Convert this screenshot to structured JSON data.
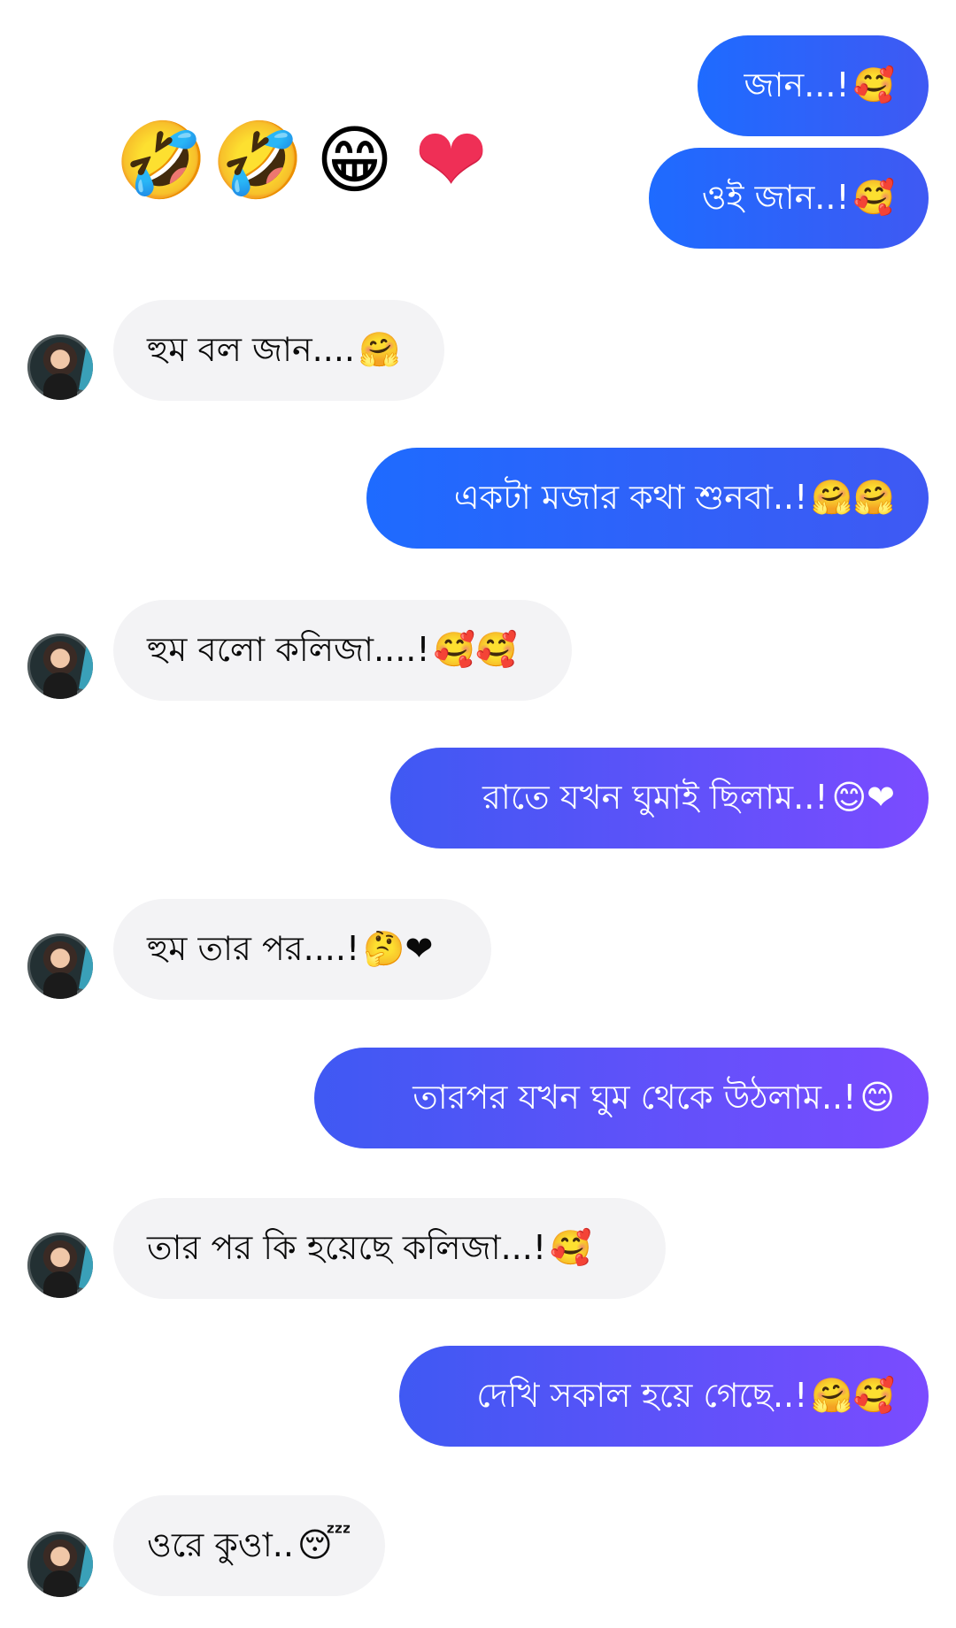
{
  "chat": {
    "top_fragment": "",
    "big_emojis": [
      "🤣",
      "🤣",
      "😁",
      "❤"
    ],
    "messages": [
      {
        "id": "m1",
        "side": "out",
        "text": "জান...!",
        "emoji": "🥰"
      },
      {
        "id": "m2",
        "side": "out",
        "text": "ওই জান..!",
        "emoji": "🥰"
      },
      {
        "id": "m3",
        "side": "in",
        "text": "হুম বল জান....",
        "emoji": "🤗"
      },
      {
        "id": "m4",
        "side": "out",
        "text": "একটা মজার কথা শুনবা..!",
        "emoji": "🤗🤗"
      },
      {
        "id": "m5",
        "side": "in",
        "text": "হুম বলো কলিজা....!",
        "emoji": "🥰🥰"
      },
      {
        "id": "m6",
        "side": "out",
        "text": "রাতে যখন ঘুমাই ছিলাম..!",
        "emoji": "😊❤"
      },
      {
        "id": "m7",
        "side": "in",
        "text": "হুম তার পর....!",
        "emoji": "🤔❤"
      },
      {
        "id": "m8",
        "side": "out",
        "text": "তারপর যখন ঘুম থেকে উঠলাম..!",
        "emoji": "😊"
      },
      {
        "id": "m9",
        "side": "in",
        "text": "তার পর কি হয়েছে কলিজা...!",
        "emoji": "🥰"
      },
      {
        "id": "m10",
        "side": "out",
        "text": "দেখি সকাল হয়ে গেছে..!",
        "emoji": "🤗🥰"
      },
      {
        "id": "m11",
        "side": "in",
        "text": "ওরে কুওা..",
        "emoji": "😴"
      }
    ]
  },
  "colors": {
    "outgoing_start": "#1e6bff",
    "outgoing_mid": "#3f59f3",
    "outgoing_end": "#7b4bff",
    "incoming_bg": "#f3f3f5",
    "incoming_text": "#0a0a0a"
  }
}
